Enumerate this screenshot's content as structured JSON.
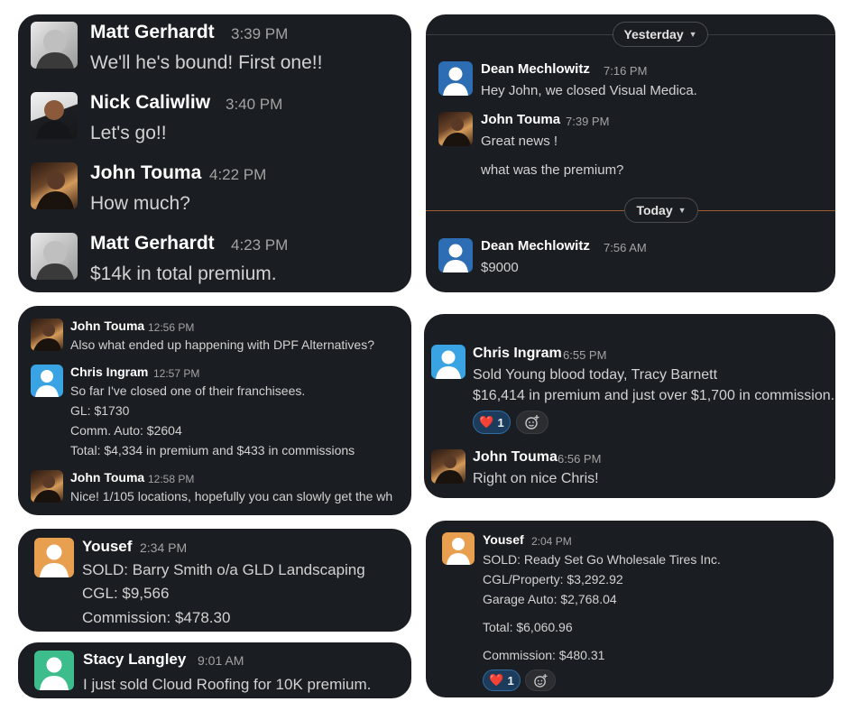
{
  "colors": {
    "card_bg": "#1a1d21",
    "blue_avatar": "#2c6db3",
    "light_blue_avatar": "#3aa3e3",
    "orange_avatar": "#e8a050",
    "green_avatar": "#3dbd8b",
    "reaction_bg": "#1d3c5c"
  },
  "card1": {
    "messages": [
      {
        "name": "Matt Gerhardt",
        "time": "3:39 PM",
        "text": "We'll he's bound!  First one!!",
        "avatar": "photo-matt"
      },
      {
        "name": "Nick Caliwliw",
        "time": "3:40 PM",
        "text": "Let's go!!",
        "avatar": "photo-nick"
      },
      {
        "name": "John Touma",
        "time": "4:22 PM",
        "text": "How much?",
        "avatar": "photo-john"
      },
      {
        "name": "Matt Gerhardt",
        "time": "4:23 PM",
        "text": "$14k in total premium.",
        "avatar": "photo-matt"
      }
    ]
  },
  "card2": {
    "divider_yesterday": "Yesterday",
    "divider_today": "Today",
    "messages": [
      {
        "name": "Dean Mechlowitz",
        "time": "7:16 PM",
        "text": "Hey John, we closed Visual Medica.",
        "avatar": "default-user-icon"
      },
      {
        "name": "John Touma",
        "time": "7:39 PM",
        "text": "Great news !",
        "avatar": "photo-john"
      },
      {
        "text": "what was the premium?"
      },
      {
        "name": "Dean Mechlowitz",
        "time": "7:56 AM",
        "text": "$9000",
        "avatar": "default-user-icon"
      }
    ]
  },
  "card3": {
    "messages": [
      {
        "name": "John Touma",
        "time": "12:56 PM",
        "text": "Also what ended up happening with DPF Alternatives?",
        "avatar": "photo-john"
      },
      {
        "name": "Chris Ingram",
        "time": "12:57 PM",
        "lines": [
          "So far I've closed one of their franchisees.",
          "GL: $1730",
          "Comm. Auto: $2604",
          "Total: $4,334 in premium and $433 in commissions"
        ],
        "avatar": "default-user-icon"
      },
      {
        "name": "John Touma",
        "time": "12:58 PM",
        "text": "Nice! 1/105 locations, hopefully you can slowly get the wh",
        "avatar": "photo-john"
      }
    ]
  },
  "card4": {
    "messages": [
      {
        "name": "Chris Ingram",
        "time": "6:55 PM",
        "lines": [
          "Sold Young blood today, Tracy Barnett",
          "$16,414 in premium and just over $1,700 in commission."
        ],
        "avatar": "default-user-icon"
      },
      {
        "name": "John Touma",
        "time": "6:56 PM",
        "text": "Right on nice Chris!",
        "avatar": "photo-john"
      }
    ],
    "reaction": {
      "emoji": "❤️",
      "count": "1"
    }
  },
  "card5": {
    "messages": [
      {
        "name": "Yousef",
        "time": "2:34 PM",
        "lines": [
          "SOLD: Barry Smith o/a GLD Landscaping",
          "CGL: $9,566",
          "Commission: $478.30"
        ],
        "avatar": "default-user-icon"
      }
    ]
  },
  "card6": {
    "messages": [
      {
        "name": "Yousef",
        "time": "2:04 PM",
        "lines": [
          "SOLD: Ready Set Go Wholesale Tires Inc.",
          "CGL/Property: $3,292.92",
          "Garage Auto: $2,768.04",
          "Total: $6,060.96",
          "Commission: $480.31"
        ],
        "avatar": "default-user-icon"
      }
    ],
    "reaction": {
      "emoji": "❤️",
      "count": "1"
    }
  },
  "card7": {
    "messages": [
      {
        "name": "Stacy Langley",
        "time": "9:01 AM",
        "text": "I just sold Cloud Roofing for 10K premium.",
        "avatar": "default-user-icon"
      }
    ]
  },
  "icons": {
    "chevron": "chevron-down-icon",
    "add_reaction": "add-reaction-icon",
    "heart": "heart-emoji"
  }
}
